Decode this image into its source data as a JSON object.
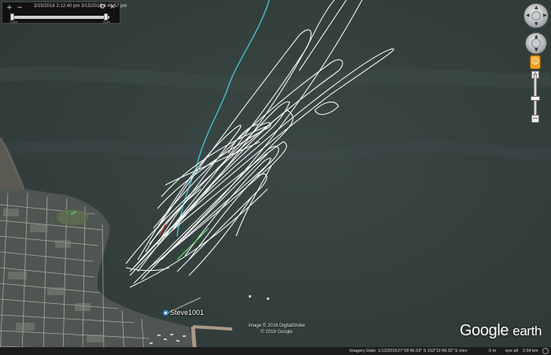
{
  "timeslider": {
    "range_text": "3/15/2016  2:12:40 pm   3/15/2016  4:46:57 pm",
    "left_label": "2 pm",
    "right_label": "4 pm",
    "icon_zoom_in": "+",
    "icon_zoom_out": "−",
    "icon_settings": "⚙",
    "icon_close": "×"
  },
  "navigation": {
    "zoom_in_label": "+",
    "zoom_out_label": "−",
    "pegman_label": "☺"
  },
  "placemark": {
    "label": "Steve1001"
  },
  "imagery_credit": {
    "line1": "Image © 2016 DigitalGlobe",
    "line2": "© 2016 Google"
  },
  "logo": {
    "word1": "Google",
    "word2": "earth"
  },
  "status_bar": {
    "imagery_date": "Imagery Date: 1/12/2016",
    "coordinates": "27°26'46.93\" S  153°11'49.32\" E  elev",
    "elevation": "0 m",
    "eye_alt": "eye alt",
    "eye_alt_value": "2.64 km"
  },
  "colors": {
    "water": "#33413f",
    "track": "#ffffff",
    "track_cyan": "#3fc2d2",
    "track_green": "#6de06a",
    "land": "#4f5551",
    "pegman": "#f2a21b"
  }
}
